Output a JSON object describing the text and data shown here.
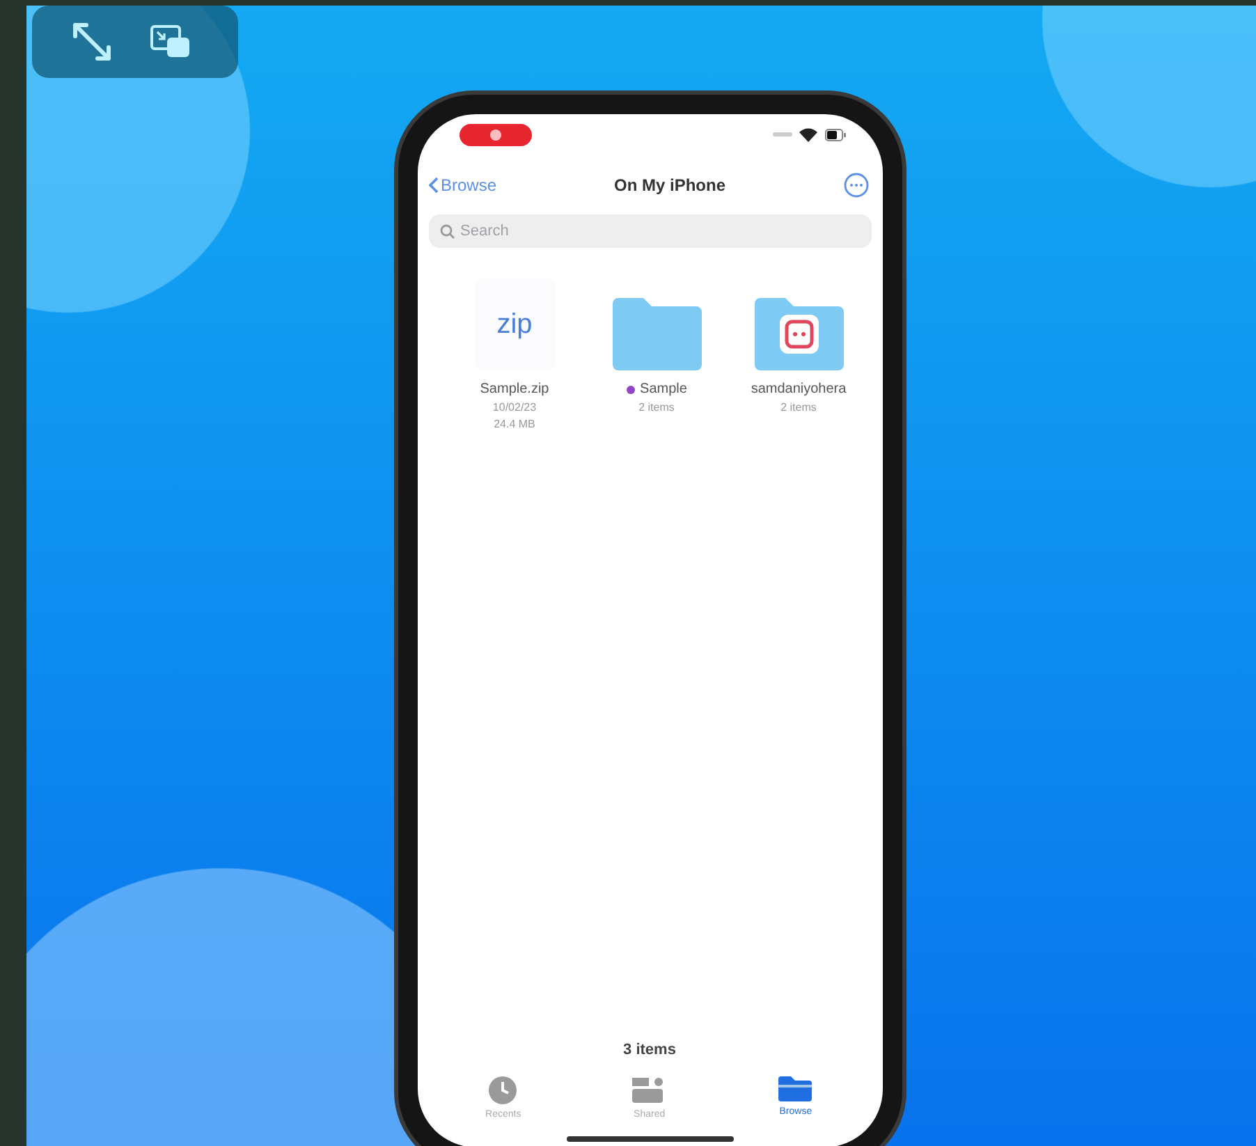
{
  "status_bar": {
    "recording": true
  },
  "nav": {
    "back": "Browse",
    "title": "On My iPhone"
  },
  "search": {
    "placeholder": "Search"
  },
  "items": [
    {
      "kind": "zip",
      "icon_text": "zip",
      "name": "Sample.zip",
      "meta": [
        "10/02/23",
        "24.4 MB"
      ]
    },
    {
      "kind": "folder",
      "name": "Sample",
      "color": "#8e44c4",
      "meta": [
        "2 items"
      ]
    },
    {
      "kind": "app-folder",
      "name": "samdaniyohera",
      "meta": [
        "2 items"
      ]
    }
  ],
  "footer": "3 items",
  "tabs": [
    {
      "kind": "recents",
      "label": "Recents",
      "selected": false
    },
    {
      "kind": "shared",
      "label": "Shared",
      "selected": false
    },
    {
      "kind": "browse",
      "label": "Browse",
      "selected": true
    }
  ]
}
